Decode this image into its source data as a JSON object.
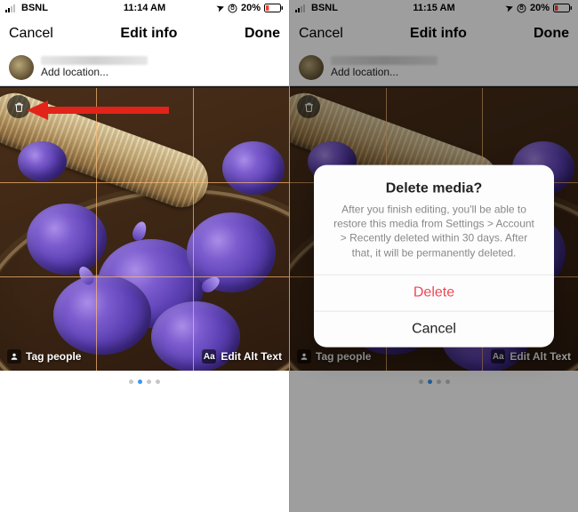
{
  "left": {
    "status": {
      "carrier": "BSNL",
      "time": "11:14 AM",
      "battery": "20%"
    },
    "nav": {
      "cancel": "Cancel",
      "title": "Edit info",
      "done": "Done"
    },
    "meta": {
      "add_location": "Add location..."
    },
    "photo": {
      "tag_people": "Tag people",
      "edit_alt": "Edit Alt Text",
      "alt_chip_icon": "Aa"
    },
    "pager_active_index": 1,
    "pager_count": 4
  },
  "right": {
    "status": {
      "carrier": "BSNL",
      "time": "11:15 AM",
      "battery": "20%"
    },
    "nav": {
      "cancel": "Cancel",
      "title": "Edit info",
      "done": "Done"
    },
    "meta": {
      "add_location": "Add location..."
    },
    "photo": {
      "tag_people": "Tag people",
      "edit_alt": "Edit Alt Text",
      "alt_chip_icon": "Aa"
    },
    "pager_active_index": 1,
    "pager_count": 4,
    "alert": {
      "title": "Delete media?",
      "message": "After you finish editing, you'll be able to restore this media from Settings > Account > Recently deleted within 30 days. After that, it will be permanently deleted.",
      "delete": "Delete",
      "cancel": "Cancel"
    }
  },
  "icons": {
    "location_arrow": "➤",
    "battery_low_color": "#ff3b30"
  }
}
